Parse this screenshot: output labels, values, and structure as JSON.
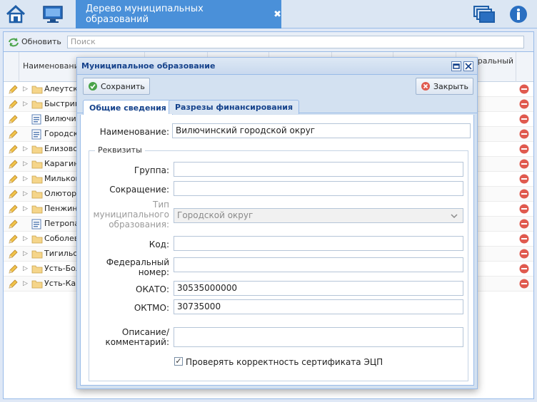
{
  "topbar": {
    "tab_title": "Дерево муниципальных образований",
    "tab_close": "✖"
  },
  "grid": {
    "refresh_label": "Обновить",
    "search_placeholder": "Поиск",
    "col_name": "Наименование",
    "col_fed_1": "еральный",
    "col_fed_2": "р",
    "rows": [
      {
        "label": "Алеутский",
        "kind": "folder"
      },
      {
        "label": "Быстрин",
        "kind": "folder"
      },
      {
        "label": "Вилючин",
        "kind": "doc"
      },
      {
        "label": "Городск",
        "kind": "doc"
      },
      {
        "label": "Елизовск",
        "kind": "folder"
      },
      {
        "label": "Карагинс",
        "kind": "folder"
      },
      {
        "label": "Мильков",
        "kind": "folder"
      },
      {
        "label": "Олюторс",
        "kind": "folder"
      },
      {
        "label": "Пенжинс",
        "kind": "folder"
      },
      {
        "label": "Петропав",
        "kind": "doc"
      },
      {
        "label": "Соболево",
        "kind": "folder"
      },
      {
        "label": "Тигильск",
        "kind": "folder"
      },
      {
        "label": "Усть-Бол",
        "kind": "folder"
      },
      {
        "label": "Усть-Кам",
        "kind": "folder"
      }
    ]
  },
  "modal": {
    "title": "Муниципальное образование",
    "save_label": "Сохранить",
    "close_label": "Закрыть",
    "tabs": [
      "Общие сведения",
      "Разрезы финансирования"
    ],
    "name_label": "Наименование:",
    "name_value": "Вилючинский городской округ",
    "requisites_legend": "Реквизиты",
    "group_label": "Группа:",
    "group_value": "",
    "short_label": "Сокращение:",
    "short_value": "",
    "type_label_1": "Тип",
    "type_label_2": "муниципального",
    "type_label_3": "образования:",
    "type_value": "Городской округ",
    "code_label": "Код:",
    "code_value": "",
    "fed_label_1": "Федеральный",
    "fed_label_2": "номер:",
    "fed_value": "",
    "okato_label": "ОКАТО:",
    "okato_value": "30535000000",
    "oktmo_label": "ОКТМО:",
    "oktmo_value": "30735000",
    "desc_label_1": "Описание/",
    "desc_label_2": "комментарий:",
    "desc_value": "",
    "cert_label": "Проверять корректность сертификата ЭЦП",
    "cert_checked": "✓"
  },
  "colors": {
    "accent": "#4a90d9",
    "header_text": "#15428b",
    "delete_red": "#e05a4f"
  }
}
